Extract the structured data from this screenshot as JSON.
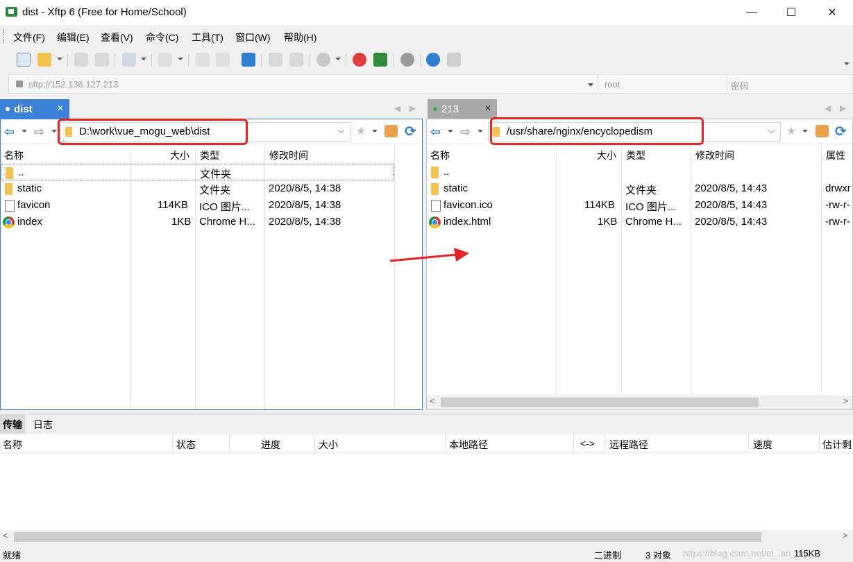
{
  "window": {
    "title": "dist - Xftp 6 (Free for Home/School)",
    "minimize": "—",
    "maximize": "☐",
    "close": "✕"
  },
  "menu": [
    "文件(F)",
    "编辑(E)",
    "查看(V)",
    "命令(C)",
    "工具(T)",
    "窗口(W)",
    "帮助(H)"
  ],
  "address": {
    "host": "sftp://152.136.127.213",
    "user_placeholder": "root",
    "password_placeholder": "密码"
  },
  "local": {
    "tab_label": "dist",
    "path": "D:\\work\\vue_mogu_web\\dist",
    "columns": [
      "名称",
      "大小",
      "类型",
      "修改时间"
    ],
    "rows": [
      {
        "name": "..",
        "size": "",
        "type": "文件夹",
        "modified": "",
        "icon": "folder-icon"
      },
      {
        "name": "static",
        "size": "",
        "type": "文件夹",
        "modified": "2020/8/5, 14:38",
        "icon": "folder-icon"
      },
      {
        "name": "favicon",
        "size": "114KB",
        "type": "ICO 图片...",
        "modified": "2020/8/5, 14:38",
        "icon": "file-icon"
      },
      {
        "name": "index",
        "size": "1KB",
        "type": "Chrome H...",
        "modified": "2020/8/5, 14:38",
        "icon": "chrome-icon"
      }
    ]
  },
  "remote": {
    "tab_label": "213",
    "path": "/usr/share/nginx/encyclopedism",
    "columns": [
      "名称",
      "大小",
      "类型",
      "修改时间",
      "属性"
    ],
    "rows": [
      {
        "name": "..",
        "size": "",
        "type": "",
        "modified": "",
        "attr": "",
        "icon": "folder-icon"
      },
      {
        "name": "static",
        "size": "",
        "type": "文件夹",
        "modified": "2020/8/5, 14:43",
        "attr": "drwxr",
        "icon": "folder-icon"
      },
      {
        "name": "favicon.ico",
        "size": "114KB",
        "type": "ICO 图片...",
        "modified": "2020/8/5, 14:43",
        "attr": "-rw-r-",
        "icon": "file-icon"
      },
      {
        "name": "index.html",
        "size": "1KB",
        "type": "Chrome H...",
        "modified": "2020/8/5, 14:43",
        "attr": "-rw-r-",
        "icon": "chrome-icon"
      }
    ]
  },
  "transfer": {
    "tabs": [
      "传输",
      "日志"
    ],
    "columns": [
      "名称",
      "状态",
      "进度",
      "大小",
      "本地路径",
      "<->",
      "远程路径",
      "速度",
      "估计剩"
    ]
  },
  "status": {
    "ready": "就绪",
    "mode": "二进制",
    "objects": "3 对象",
    "watermark": "https://blog.csdn.net/el...an_my...",
    "size": "115KB"
  },
  "colors": {
    "accent": "#3c82d6",
    "highlight": "#e82424",
    "connected_dot": "#22b14c"
  }
}
